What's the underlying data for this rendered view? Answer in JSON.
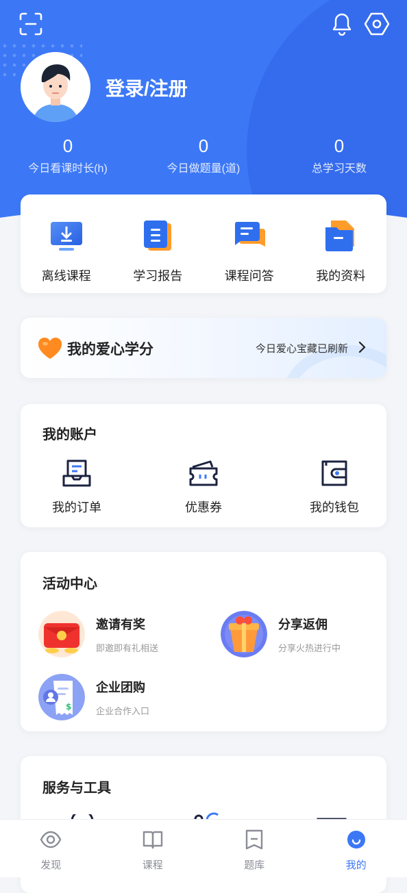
{
  "header": {
    "login_label": "登录/注册",
    "accent": "#3c78f6"
  },
  "stats": [
    {
      "value": "0",
      "label": "今日看课时长(h)"
    },
    {
      "value": "0",
      "label": "今日做题量(道)"
    },
    {
      "value": "0",
      "label": "总学习天数"
    }
  ],
  "quick": [
    {
      "label": "离线课程",
      "icon": "download-monitor-icon"
    },
    {
      "label": "学习报告",
      "icon": "report-icon"
    },
    {
      "label": "课程问答",
      "icon": "qa-chat-icon"
    },
    {
      "label": "我的资料",
      "icon": "folder-icon"
    }
  ],
  "love": {
    "title": "我的爱心学分",
    "subtitle": "今日爱心宝藏已刷新",
    "heart_color": "#ff8a1f"
  },
  "account": {
    "title": "我的账户",
    "items": [
      {
        "label": "我的订单",
        "icon": "order-icon"
      },
      {
        "label": "优惠券",
        "icon": "coupon-icon"
      },
      {
        "label": "我的钱包",
        "icon": "wallet-icon"
      }
    ]
  },
  "activity": {
    "title": "活动中心",
    "items": [
      {
        "title": "邀请有奖",
        "subtitle": "即邀即有礼相送",
        "icon": "red-envelope-icon"
      },
      {
        "title": "分享返佣",
        "subtitle": "分享火热进行中",
        "icon": "gift-box-icon"
      },
      {
        "title": "企业团购",
        "subtitle": "企业合作入口",
        "icon": "receipt-icon"
      }
    ]
  },
  "services": {
    "title": "服务与工具"
  },
  "tabbar": [
    {
      "label": "发现",
      "icon": "eye-icon",
      "active": false
    },
    {
      "label": "课程",
      "icon": "book-icon",
      "active": false
    },
    {
      "label": "题库",
      "icon": "question-bank-icon",
      "active": false
    },
    {
      "label": "我的",
      "icon": "profile-smile-icon",
      "active": true
    }
  ]
}
